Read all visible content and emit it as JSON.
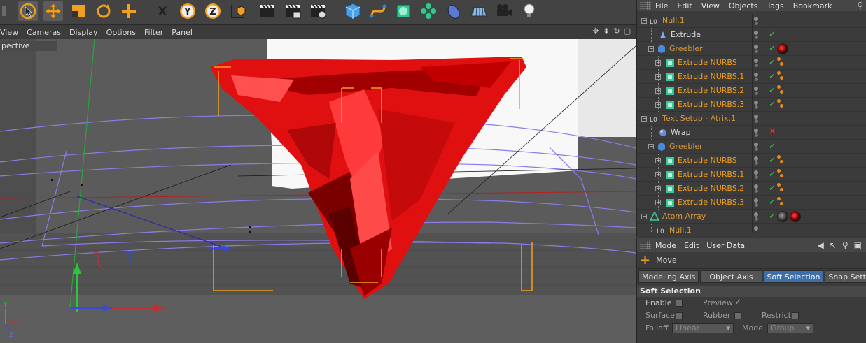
{
  "toolbar": {
    "x_label": "X",
    "y_label": "Y",
    "z_label": "Z",
    "icons": [
      "undo-icon",
      "live-selection-icon",
      "move-icon",
      "scale-icon",
      "rotate-icon",
      "add-icon",
      "x-axis-lock-icon",
      "y-axis-lock-icon",
      "z-axis-lock-icon",
      "coordinate-system-icon",
      "render-view-icon",
      "render-picture-viewer-icon",
      "render-settings-icon",
      "cube-icon",
      "spline-icon",
      "subdivision-icon",
      "array-icon",
      "deformer-icon",
      "floor-icon",
      "camera-icon",
      "light-icon"
    ]
  },
  "viewport": {
    "menu": [
      "View",
      "Cameras",
      "Display",
      "Options",
      "Filter",
      "Panel"
    ],
    "camera_label": "pective",
    "axis_labels": {
      "y": "Y",
      "x": "X",
      "z": "Z"
    }
  },
  "object_manager": {
    "menu": [
      "File",
      "Edit",
      "View",
      "Objects",
      "Tags",
      "Bookmark"
    ],
    "rows": [
      {
        "name": "Null.1",
        "color": "orange-dim",
        "check": "none"
      },
      {
        "name": "Extrude",
        "color": "white",
        "check": "green"
      },
      {
        "name": "Greebler",
        "color": "orange-dim",
        "check": "green"
      },
      {
        "name": "Extrude NURBS",
        "color": "orange",
        "check": "green"
      },
      {
        "name": "Extrude NURBS.1",
        "color": "orange",
        "check": "green"
      },
      {
        "name": "Extrude NURBS.2",
        "color": "orange",
        "check": "green"
      },
      {
        "name": "Extrude NURBS.3",
        "color": "orange",
        "check": "green"
      },
      {
        "name": "Text Setup - Atrix.1",
        "color": "orange-dim",
        "check": "none"
      },
      {
        "name": "Wrap",
        "color": "white",
        "check": "red"
      },
      {
        "name": "Greebler",
        "color": "orange-dim",
        "check": "green"
      },
      {
        "name": "Extrude NURBS",
        "color": "orange",
        "check": "green"
      },
      {
        "name": "Extrude NURBS.1",
        "color": "orange",
        "check": "green"
      },
      {
        "name": "Extrude NURBS.2",
        "color": "orange",
        "check": "green"
      },
      {
        "name": "Extrude NURBS.3",
        "color": "orange",
        "check": "green"
      },
      {
        "name": "Atom Array",
        "color": "orange-dim",
        "check": "green"
      },
      {
        "name": "Null.1",
        "color": "orange-dim",
        "check": "none"
      }
    ]
  },
  "attribute_manager": {
    "menu": [
      "Mode",
      "Edit",
      "User Data"
    ],
    "mode_title": "Move",
    "tabs": [
      "Modeling Axis",
      "Object Axis",
      "Soft Selection",
      "Snap Settings"
    ],
    "active_tab": "Soft Selection",
    "section": "Soft Selection",
    "fields": {
      "enable": "Enable",
      "preview": "Preview",
      "surface": "Surface",
      "rubber": "Rubber",
      "restrict": "Restrict",
      "falloff": "Falloff",
      "falloff_value": "Linear",
      "mode": "Mode",
      "mode_value": "Group"
    }
  },
  "colors": {
    "accent_orange": "#f0a020",
    "active_tab_blue": "#3f6fa8",
    "check_green": "#27d23c",
    "disabled_red": "#e43a3a",
    "model_red": "#e01010"
  }
}
